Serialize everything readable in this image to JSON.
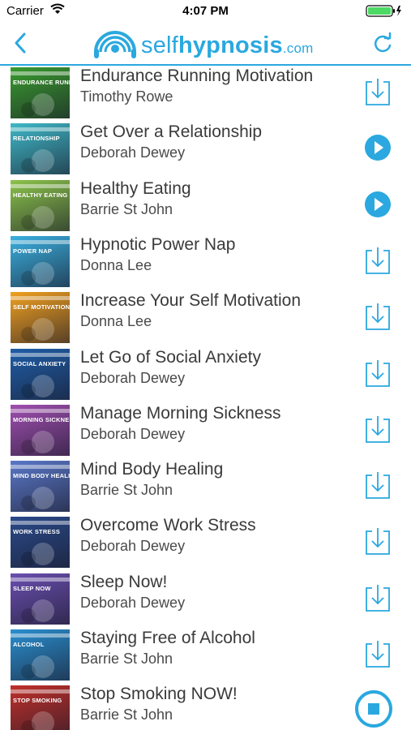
{
  "status_bar": {
    "carrier": "Carrier",
    "time": "4:07 PM"
  },
  "header": {
    "logo_self": "self",
    "logo_hypnosis": "hypnosis",
    "logo_com": ".com",
    "accent_color": "#2aa8df"
  },
  "tracks": [
    {
      "title": "Endurance Running Motivation",
      "author": "Timothy Rowe",
      "cover": "Endurance Running",
      "cover_color": "#3a9b2f",
      "action": "download"
    },
    {
      "title": "Get Over a Relationship",
      "author": "Deborah Dewey",
      "cover": "Relationship",
      "cover_color": "#3fb8c7",
      "action": "play"
    },
    {
      "title": "Healthy Eating",
      "author": "Barrie St John",
      "cover": "Healthy Eating",
      "cover_color": "#8bc34a",
      "action": "play"
    },
    {
      "title": "Hypnotic Power Nap",
      "author": "Donna Lee",
      "cover": "Power Nap",
      "cover_color": "#3ab0e0",
      "action": "download"
    },
    {
      "title": "Increase Your Self Motivation",
      "author": "Donna Lee",
      "cover": "Self Motivation",
      "cover_color": "#f0a020",
      "action": "download"
    },
    {
      "title": "Let Go of Social Anxiety",
      "author": "Deborah Dewey",
      "cover": "Social Anxiety",
      "cover_color": "#1f5ea8",
      "action": "download"
    },
    {
      "title": "Manage Morning Sickness",
      "author": "Deborah Dewey",
      "cover": "Morning Sickness",
      "cover_color": "#a04fb0",
      "action": "download"
    },
    {
      "title": "Mind Body Healing",
      "author": "Barrie St John",
      "cover": "Mind Body Healing",
      "cover_color": "#5a78c8",
      "action": "download"
    },
    {
      "title": "Overcome Work Stress",
      "author": "Deborah Dewey",
      "cover": "Work Stress",
      "cover_color": "#2a4a8a",
      "action": "download"
    },
    {
      "title": "Sleep Now!",
      "author": "Deborah Dewey",
      "cover": "Sleep Now",
      "cover_color": "#6a4fb0",
      "action": "download"
    },
    {
      "title": "Staying Free of Alcohol",
      "author": "Barrie St John",
      "cover": "Alcohol",
      "cover_color": "#2a8fd0",
      "action": "download"
    },
    {
      "title": "Stop Smoking NOW!",
      "author": "Barrie St John",
      "cover": "Stop Smoking",
      "cover_color": "#c0302a",
      "action": "stop"
    }
  ]
}
